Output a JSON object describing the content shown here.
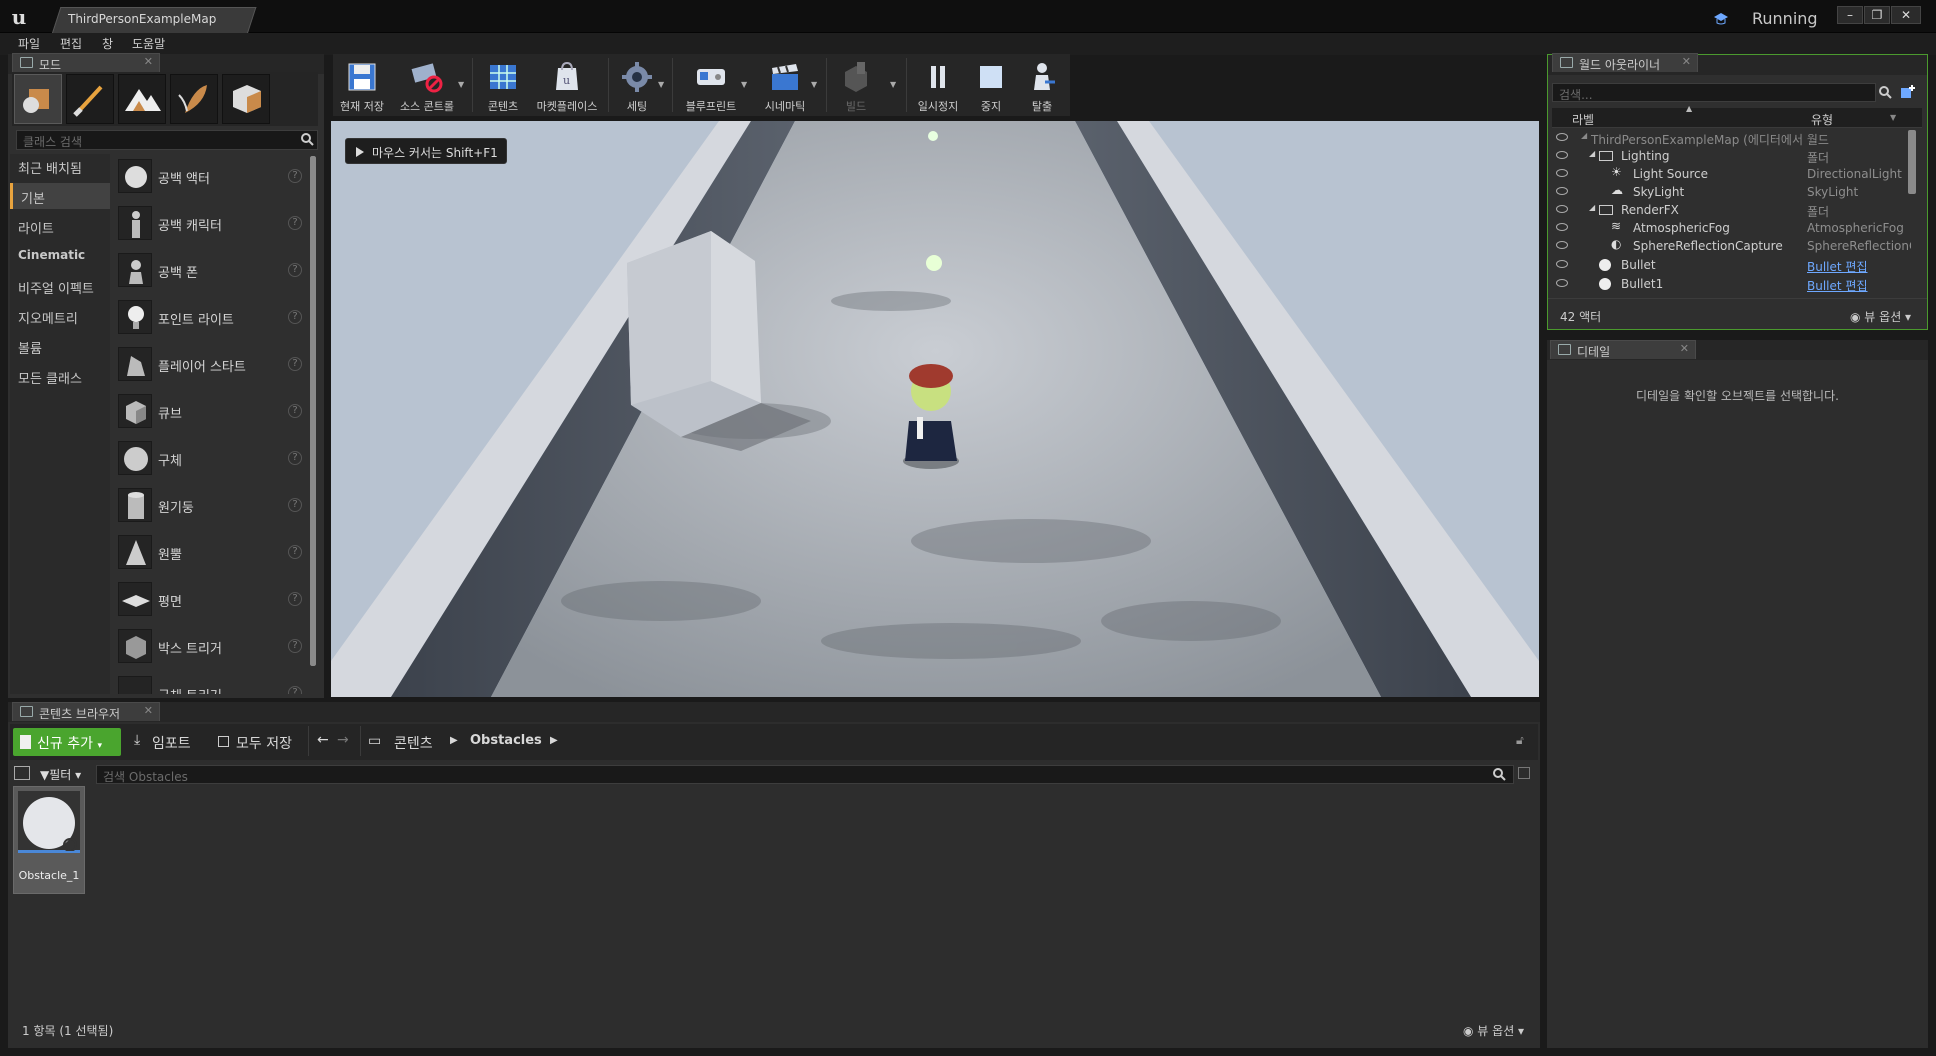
{
  "titlebar": {
    "doc_tab": "ThirdPersonExampleMap",
    "status": "Running",
    "window_buttons": [
      "–",
      "❐",
      "✕"
    ]
  },
  "menu": [
    "파일",
    "편집",
    "창",
    "도움말"
  ],
  "modes_panel": {
    "tab_label": "모드",
    "search_placeholder": "클래스 검색",
    "categories": [
      "최근 배치됨",
      "기본",
      "라이트",
      "Cinematic",
      "비주얼 이펙트",
      "지오메트리",
      "볼륨",
      "모든 클래스"
    ],
    "selected_category": "기본",
    "items": [
      "공백 액터",
      "공백 캐릭터",
      "공백 폰",
      "포인트 라이트",
      "플레이어 스타트",
      "큐브",
      "구체",
      "원기둥",
      "원뿔",
      "평면",
      "박스 트리거",
      "구체 트리거"
    ]
  },
  "toolbar": {
    "buttons": [
      "현재 저장",
      "소스 콘트롤",
      "콘텐츠",
      "마켓플레이스",
      "세팅",
      "블루프린트",
      "시네마틱",
      "빌드",
      "일시정지",
      "중지",
      "탈출"
    ]
  },
  "viewport": {
    "hint": "마우스 커서는 Shift+F1"
  },
  "outliner": {
    "tab_label": "월드 아웃라이너",
    "search_placeholder": "검색...",
    "col_label": "라벨",
    "col_type": "유형",
    "rows": [
      {
        "label": "ThirdPersonExampleMap (에디터에서 월드",
        "type": ""
      },
      {
        "label": "Lighting",
        "type": "폴더"
      },
      {
        "label": "Light Source",
        "type": "DirectionalLight"
      },
      {
        "label": "SkyLight",
        "type": "SkyLight"
      },
      {
        "label": "RenderFX",
        "type": "폴더"
      },
      {
        "label": "AtmosphericFog",
        "type": "AtmosphericFog"
      },
      {
        "label": "SphereReflectionCapture",
        "type": "SphereReflectionC"
      },
      {
        "label": "Bullet",
        "type": "Bullet 편집"
      },
      {
        "label": "Bullet1",
        "type": "Bullet 편집"
      }
    ],
    "actor_count": "42 액터",
    "view_options": "뷰 옵션"
  },
  "details": {
    "tab_label": "디테일",
    "empty_message": "디테일을 확인할 오브젝트를 선택합니다."
  },
  "content_browser": {
    "tab_label": "콘텐츠 브라우저",
    "add_new": "신규 추가",
    "import": "임포트",
    "save_all": "모두 저장",
    "path": [
      "콘텐츠",
      "Obstacles"
    ],
    "filter": "필터",
    "search_placeholder": "검색 Obstacles",
    "asset_name": "Obstacle_1",
    "status": "1 항목 (1 선택됨)",
    "view_options": "뷰 옵션"
  },
  "colors": {
    "accent_green": "#4aa52e",
    "link_blue": "#6ea8ff",
    "selected_orange": "#e8a33e"
  }
}
